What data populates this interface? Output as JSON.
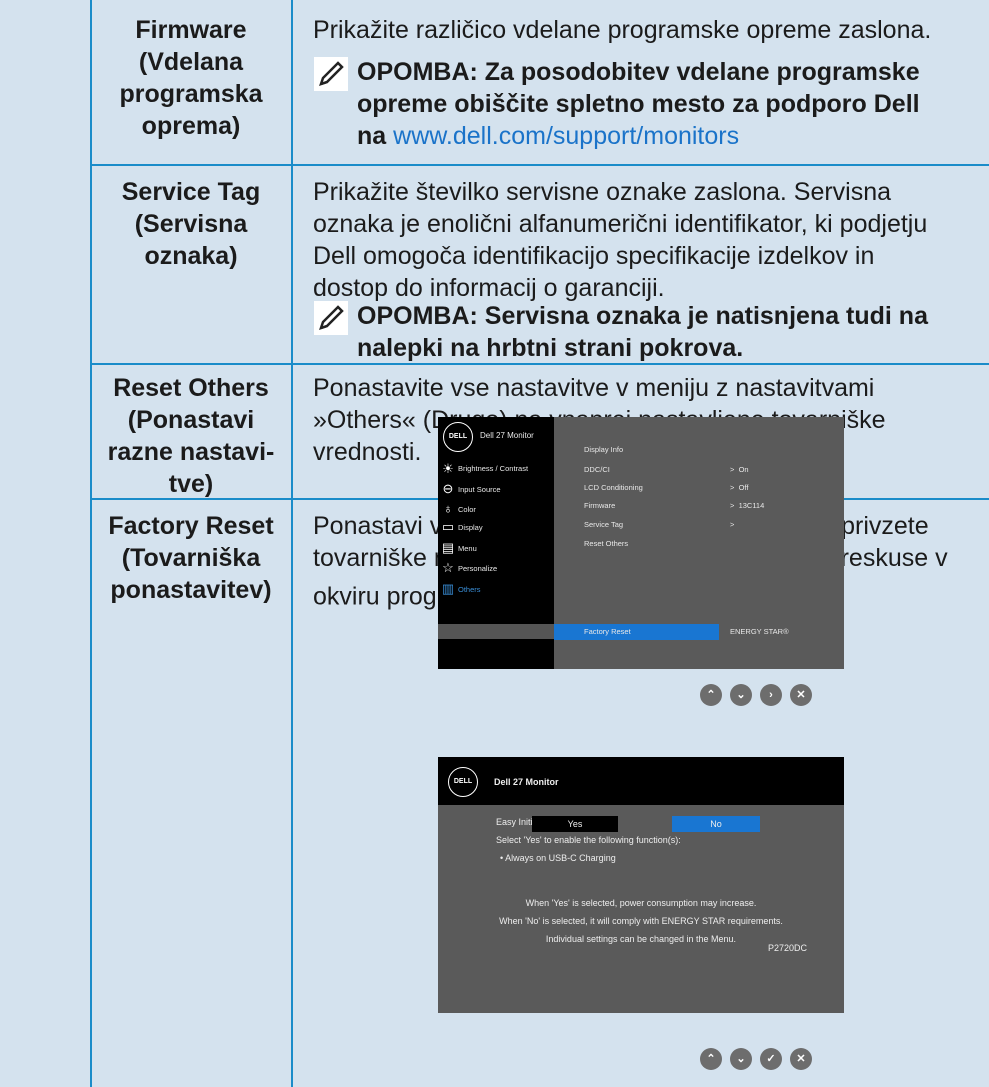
{
  "rows": [
    {
      "label": [
        "Firmware",
        "(Vdelana",
        "programska",
        "oprema)"
      ],
      "desc": "Prikažite različico vdelane programske opreme zaslona.",
      "note": [
        "OPOMBA: Za posodobitev vdelane programske",
        "opreme obiščite spletno mesto za podporo Dell"
      ],
      "note_last_prefix": "na",
      "note_link": "www.dell.com/support/monitors"
    },
    {
      "label": [
        "Service Tag",
        "(Servisna",
        "oznaka)"
      ],
      "desc": [
        "Prikažite številko servisne oznake zaslona. Servisna",
        "oznaka je enolični alfanumerični identifikator, ki podjetju",
        "Dell omogoča identifikacijo specifikacije izdelkov in",
        "dostop do informacij o garanciji."
      ],
      "note": [
        "OPOMBA: Servisna oznaka je natisnjena tudi na",
        "nalepki na hrbtni strani pokrova."
      ]
    },
    {
      "label": [
        "Reset Others",
        "(Ponastavi",
        "razne nastavi-",
        "tve)"
      ],
      "desc": [
        "Ponastavite vse nastavitve v meniju z nastavitvami",
        "»Others« (Drugo) na vnaprej nastavljene tovarniške",
        "vrednosti."
      ]
    },
    {
      "label": [
        "Factory Reset",
        "(Tovarniška",
        "ponastavitev)"
      ],
      "desc": [
        "Ponastavi vse vnaprej nastavljene vrednosti na privzete",
        "tovarniške nastavitve. To so tudi nastavitve za preskuse v"
      ],
      "desc_last_prefix": "okviru programa ENERGY STAR",
      "desc_reg": "®",
      "desc_end": "."
    }
  ],
  "osd1": {
    "logo": "DELL",
    "title": "Dell 27 Monitor",
    "menu": [
      "Brightness / Contrast",
      "Input Source",
      "Color",
      "Display",
      "Menu",
      "Personalize",
      "Others"
    ],
    "items": [
      "Display Info",
      "DDC/CI",
      "LCD Conditioning",
      "Firmware",
      "Service Tag",
      "Reset Others",
      "Factory Reset"
    ],
    "values": [
      "",
      "On",
      "Off",
      "13C114",
      "",
      "",
      "ENERGY STAR®"
    ]
  },
  "osd2": {
    "logo": "DELL",
    "title": "Dell 27 Monitor",
    "setup": "Easy Initial Setup:",
    "select": "Select 'Yes' to enable the following function(s):",
    "bullet": "• Always on USB-C Charging",
    "yes": "Yes",
    "no": "No",
    "line1": "When 'Yes' is selected, power consumption may increase.",
    "line2": "When 'No' is selected, it will comply with ENERGY STAR requirements.",
    "line3": "Individual settings can be changed in the Menu.",
    "model": "P2720DC"
  },
  "nav_icons": {
    "row1": [
      "up-icon",
      "down-icon",
      "right-icon",
      "close-icon"
    ],
    "row2": [
      "up-icon",
      "down-icon",
      "check-icon",
      "close-icon"
    ]
  }
}
